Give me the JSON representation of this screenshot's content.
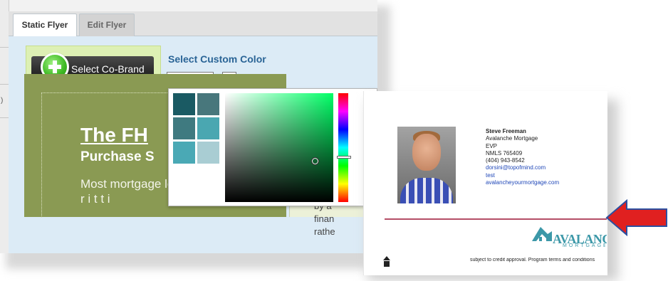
{
  "tabs": [
    {
      "label": "Static Flyer",
      "active": true
    },
    {
      "label": "Edit Flyer",
      "active": false
    }
  ],
  "cobrand": {
    "button_label": "Select Co-Brand",
    "icon": "plus-icon"
  },
  "color": {
    "title": "Select Custom Color",
    "hex_value": "#10623A",
    "selected_color": "#10623a",
    "palette": [
      "#1a5a63",
      "#48777c",
      "#3f7a80",
      "#4aa7b1",
      "#4aa9b5",
      "#a9cdd3"
    ]
  },
  "flyer": {
    "title": "The FH",
    "subtitle": "Purchase S",
    "body_line1": "Most mortgage loan programs",
    "body_line2": "r i       t t    i",
    "side_line1": "by a",
    "side_line2": "finan",
    "side_line3": "rathe"
  },
  "preview": {
    "contact": {
      "name": "Steve Freeman",
      "company": "Avalanche Mortgage",
      "title": "EVP",
      "nmls": "NMLS 765409",
      "phone": "(404) 943-8542",
      "email": "dorsini@topofmind.com",
      "extra": "test",
      "website": "avalancheyourmortgage.com"
    },
    "logo_text": "AVALANCHE",
    "logo_sub": "MORTGAGE",
    "fine_print": "subject to credit approval. Program terms and conditions",
    "accent": "#b44e66",
    "arrow_color": "#e02020"
  }
}
